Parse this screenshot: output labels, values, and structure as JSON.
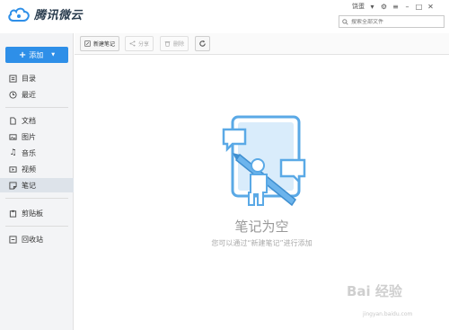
{
  "app": {
    "logo_text": "腾讯微云",
    "user_name": "饶蛋",
    "search_placeholder": "搜索全部文件"
  },
  "sidebar": {
    "add_label": "添加",
    "items": [
      {
        "label": "目录",
        "icon": "catalog-icon"
      },
      {
        "label": "最近",
        "icon": "clock-icon"
      },
      {
        "label": "文档",
        "icon": "document-icon"
      },
      {
        "label": "图片",
        "icon": "image-icon"
      },
      {
        "label": "音乐",
        "icon": "music-icon"
      },
      {
        "label": "视频",
        "icon": "video-icon"
      },
      {
        "label": "笔记",
        "icon": "note-icon",
        "active": true
      },
      {
        "label": "剪贴板",
        "icon": "clipboard-icon"
      },
      {
        "label": "回收站",
        "icon": "trash-icon"
      }
    ]
  },
  "toolbar": {
    "new_note": "新建笔记",
    "share": "分享",
    "delete": "删除"
  },
  "empty_state": {
    "title": "笔记为空",
    "hint": "您可以通过“新建笔记”进行添加"
  },
  "watermark": {
    "text": "Bai 经验",
    "url": "jingyan.baidu.com"
  },
  "colors": {
    "accent": "#2e8fe8",
    "illustration": "#5aa9e6"
  }
}
